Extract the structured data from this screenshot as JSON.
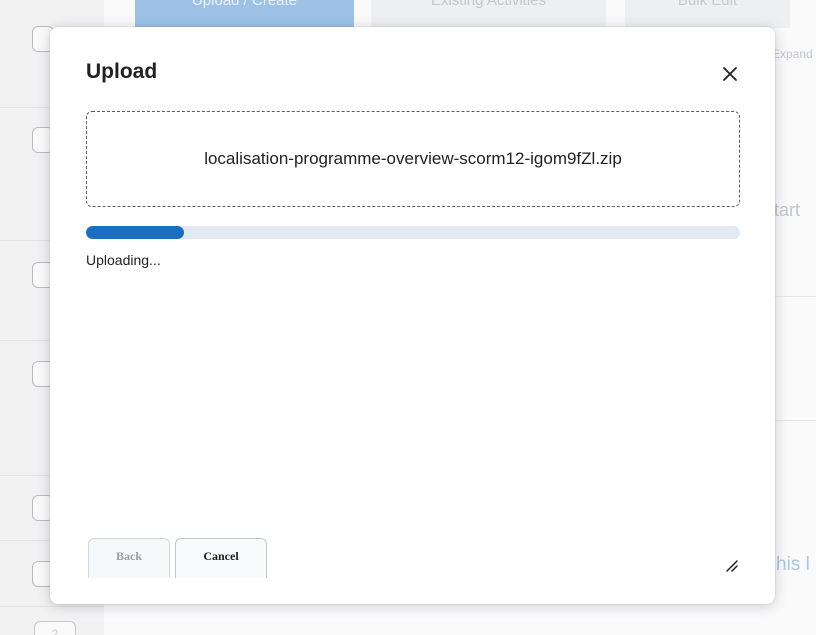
{
  "background": {
    "tabs": {
      "upload_create": "Upload / Create",
      "existing_activities": "Existing Activities",
      "bulk_edit": "Bulk Edit"
    },
    "expand_text": "Expand",
    "start_text": "tart",
    "this_text": "his l",
    "page_button": "2"
  },
  "dialog": {
    "title": "Upload",
    "file_name": "localisation-programme-overview-scorm12-igom9fZl.zip",
    "progress_fraction": 0.15,
    "status": "Uploading...",
    "back_label": "Back",
    "cancel_label": "Cancel"
  },
  "colors": {
    "accent": "#1a6fc0",
    "progress_track": "#e3e9f1"
  }
}
